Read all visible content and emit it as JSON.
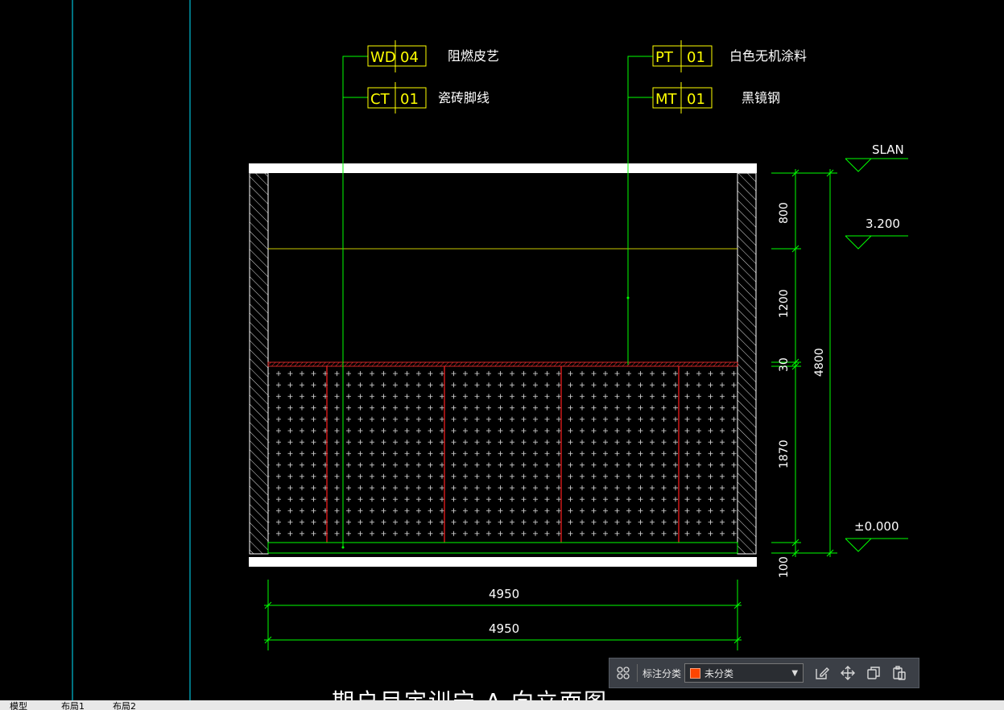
{
  "drawing": {
    "tags": [
      {
        "code": "WD",
        "number": "04",
        "desc": "阻燃皮艺"
      },
      {
        "code": "CT",
        "number": "01",
        "desc": "瓷砖脚线"
      },
      {
        "code": "PT",
        "number": "01",
        "desc": "白色无机涂料"
      },
      {
        "code": "MT",
        "number": "01",
        "desc": "黑镜钢"
      }
    ],
    "levels": {
      "top": "SLAN",
      "middle": "3.200",
      "bottom": "±0.000"
    },
    "dims_vertical": {
      "d800": "800",
      "d1200": "1200",
      "d30": "30",
      "d1870": "1870",
      "d100": "100",
      "total": "4800"
    },
    "dims_horizontal": {
      "upper": "4950",
      "lower": "4950"
    },
    "title_partial": "期户目定训宁 A 向立面图"
  },
  "toolbar": {
    "label": "标注分类",
    "select_value": "未分类",
    "swatch_color": "#ff4500",
    "icons": [
      "grid-icon",
      "edit-icon",
      "move-icon",
      "copy-icon",
      "paste-icon"
    ]
  },
  "tabs": [
    "模型",
    "布局1",
    "布局2"
  ],
  "colors": {
    "background": "#000000",
    "leader": "#00ff00",
    "tag_box": "#ffff00",
    "red_lines": "#ff2020",
    "cyan_lines": "#00e5ff"
  }
}
